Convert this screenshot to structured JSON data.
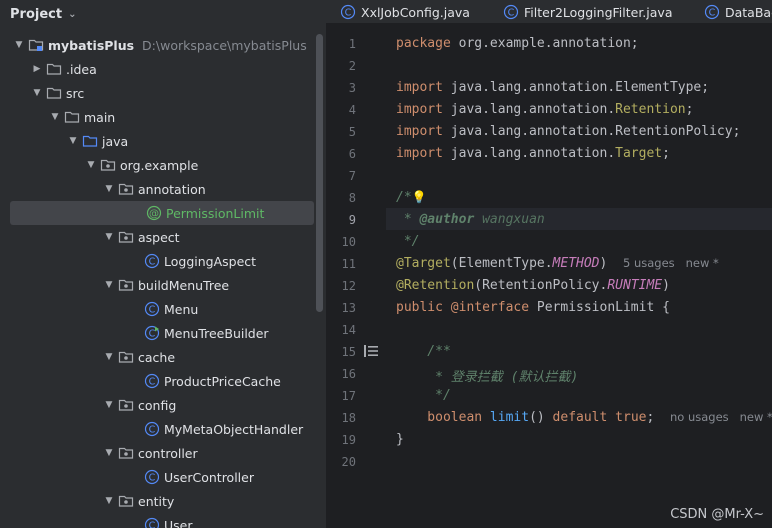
{
  "project_panel": {
    "title": "Project",
    "root_name": "mybatisPlus",
    "root_path": "D:\\workspace\\mybatisPlus",
    "tree": [
      {
        "label": "mybatisPlus"
      },
      {
        "label": ".idea"
      },
      {
        "label": "src"
      },
      {
        "label": "main"
      },
      {
        "label": "java"
      },
      {
        "label": "org.example"
      },
      {
        "label": "annotation"
      },
      {
        "label": "PermissionLimit"
      },
      {
        "label": "aspect"
      },
      {
        "label": "LoggingAspect"
      },
      {
        "label": "buildMenuTree"
      },
      {
        "label": "Menu"
      },
      {
        "label": "MenuTreeBuilder"
      },
      {
        "label": "cache"
      },
      {
        "label": "ProductPriceCache"
      },
      {
        "label": "config"
      },
      {
        "label": "MyMetaObjectHandler"
      },
      {
        "label": "controller"
      },
      {
        "label": "UserController"
      },
      {
        "label": "entity"
      },
      {
        "label": "User"
      }
    ]
  },
  "tabs": [
    {
      "label": "XxlJobConfig.java"
    },
    {
      "label": "Filter2LoggingFilter.java"
    },
    {
      "label": "DataBac"
    }
  ],
  "editor": {
    "line_numbers": [
      "1",
      "2",
      "3",
      "4",
      "5",
      "6",
      "7",
      "8",
      "9",
      "10",
      "11",
      "12",
      "13",
      "14",
      "15",
      "16",
      "17",
      "18",
      "19",
      "20"
    ],
    "current_line": 9,
    "code": {
      "l1_kw": "package",
      "l1_rest": " org.example.annotation;",
      "import": "import",
      "l3_pkg": " java.lang.annotation.",
      "l3_cls": "ElementType",
      "l3_end": ";",
      "l4_pkg": " java.lang.annotation.",
      "l4_cls": "Retention",
      "l4_end": ";",
      "l5_pkg": " java.lang.annotation.",
      "l5_cls": "RetentionPolicy",
      "l5_end": ";",
      "l6_pkg": " java.lang.annotation.",
      "l6_cls": "Target",
      "l6_end": ";",
      "l8": "/*",
      "l9_a": " * ",
      "l9_tag": "@author",
      "l9_val": " wangxuan",
      "l10": " */",
      "l11_an": "@Target",
      "l11_a": "(ElementType.",
      "l11_c": "METHOD",
      "l11_b": ")",
      "l11_hint": "5 usages   new *",
      "l12_an": "@Retention",
      "l12_a": "(RetentionPolicy.",
      "l12_c": "RUNTIME",
      "l12_b": ")",
      "l13_kw": "public",
      "l13_kw2": " @interface",
      "l13_rest": " PermissionLimit {",
      "l15": "    /**",
      "l16": "     * 登录拦截 (默认拦截)",
      "l17": "     */",
      "l18_kw": "    boolean",
      "l18_fn": " limit",
      "l18_a": "() ",
      "l18_kw2": "default",
      "l18_kw3": " true",
      "l18_b": ";",
      "l18_hint": "no usages   new *",
      "l19": "}"
    }
  },
  "watermark": "CSDN @Mr-X~"
}
